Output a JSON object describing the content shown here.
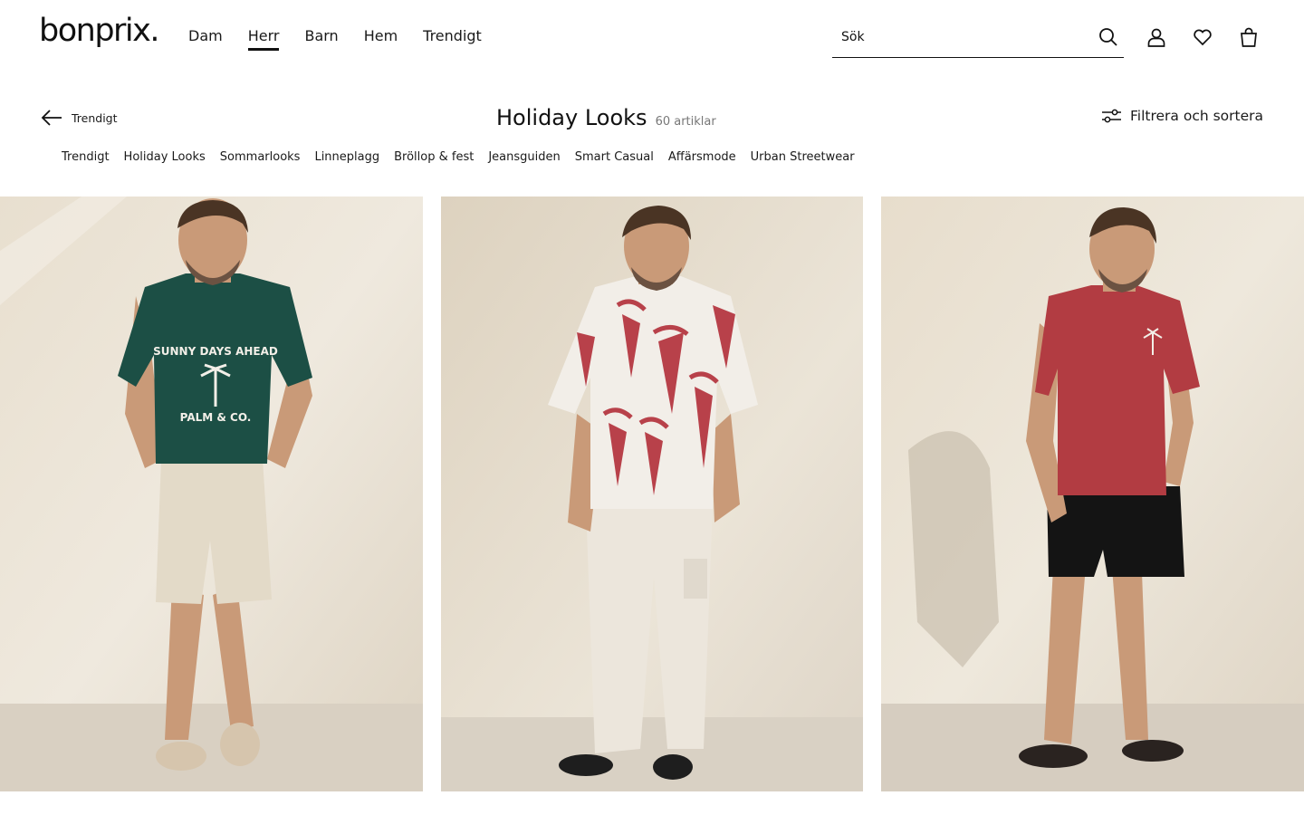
{
  "header": {
    "logo": "bonprix.",
    "nav": [
      {
        "label": "Dam",
        "active": false
      },
      {
        "label": "Herr",
        "active": true
      },
      {
        "label": "Barn",
        "active": false
      },
      {
        "label": "Hem",
        "active": false
      },
      {
        "label": "Trendigt",
        "active": false
      }
    ],
    "search": {
      "placeholder": "Sök"
    },
    "icons": [
      "search-icon",
      "user-icon",
      "heart-icon",
      "bag-icon"
    ]
  },
  "subheader": {
    "back_label": "Trendigt",
    "title": "Holiday Looks",
    "count": "60 artiklar",
    "filter_label": "Filtrera och sortera"
  },
  "categories": [
    "Trendigt",
    "Holiday Looks",
    "Sommarlooks",
    "Linneplagg",
    "Bröllop & fest",
    "Jeansguiden",
    "Smart Casual",
    "Affärsmode",
    "Urban Streetwear"
  ],
  "products": [
    {
      "shirt_text_1": "SUNNY DAYS AHEAD",
      "shirt_text_2": "PALM & CO.",
      "shirt_color": "#1c4f45",
      "bottom_color": "#e3dac8",
      "shoe_color": "#d6c5ad"
    },
    {
      "shirt_color": "#f2eee8",
      "print_color": "#b8414a",
      "bottom_color": "#ece6dc",
      "shoe_color": "#1e1e1e"
    },
    {
      "shirt_color": "#b23c42",
      "bottom_color": "#141414",
      "shoe_color": "#2a2320"
    }
  ],
  "colors": {
    "text": "#1a1a1a",
    "muted": "#777777",
    "background_wall": "#e9e2d5"
  }
}
